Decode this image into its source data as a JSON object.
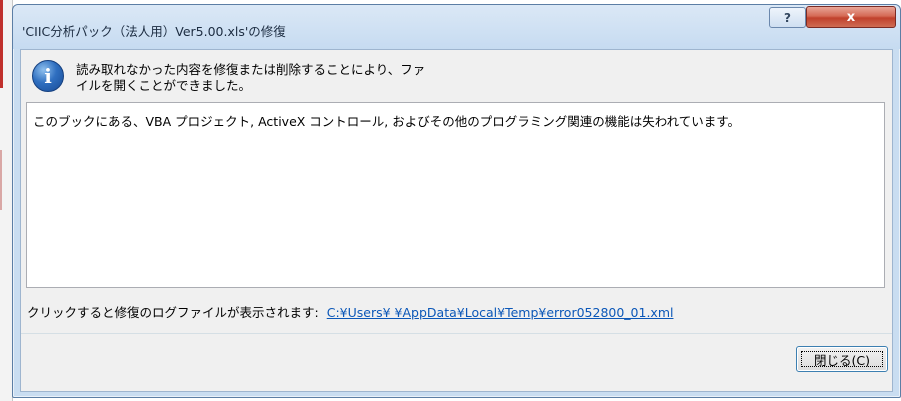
{
  "window": {
    "title": "'CIIC分析パック（法人用）Ver5.00.xls'の修復",
    "help_glyph": "?",
    "close_glyph": "x"
  },
  "message": {
    "icon": "info-icon",
    "icon_glyph": "i",
    "text": "読み取れなかった内容を修復または削除することにより、ファイルを開くことができました。"
  },
  "detail": {
    "text": "このブックにある、VBA プロジェクト, ActiveX コントロール, およびその他のプログラミング関連の機能は失われています。"
  },
  "log": {
    "label": "クリックすると修復のログファイルが表示されます:",
    "link_text": "C:¥Users¥             ¥AppData¥Local¥Temp¥error052800_01.xml"
  },
  "footer": {
    "close_button_label": "閉じる(C)"
  },
  "colors": {
    "title_bar": "#c9ddf1",
    "close_button": "#c0412c",
    "link": "#0b57b8"
  }
}
